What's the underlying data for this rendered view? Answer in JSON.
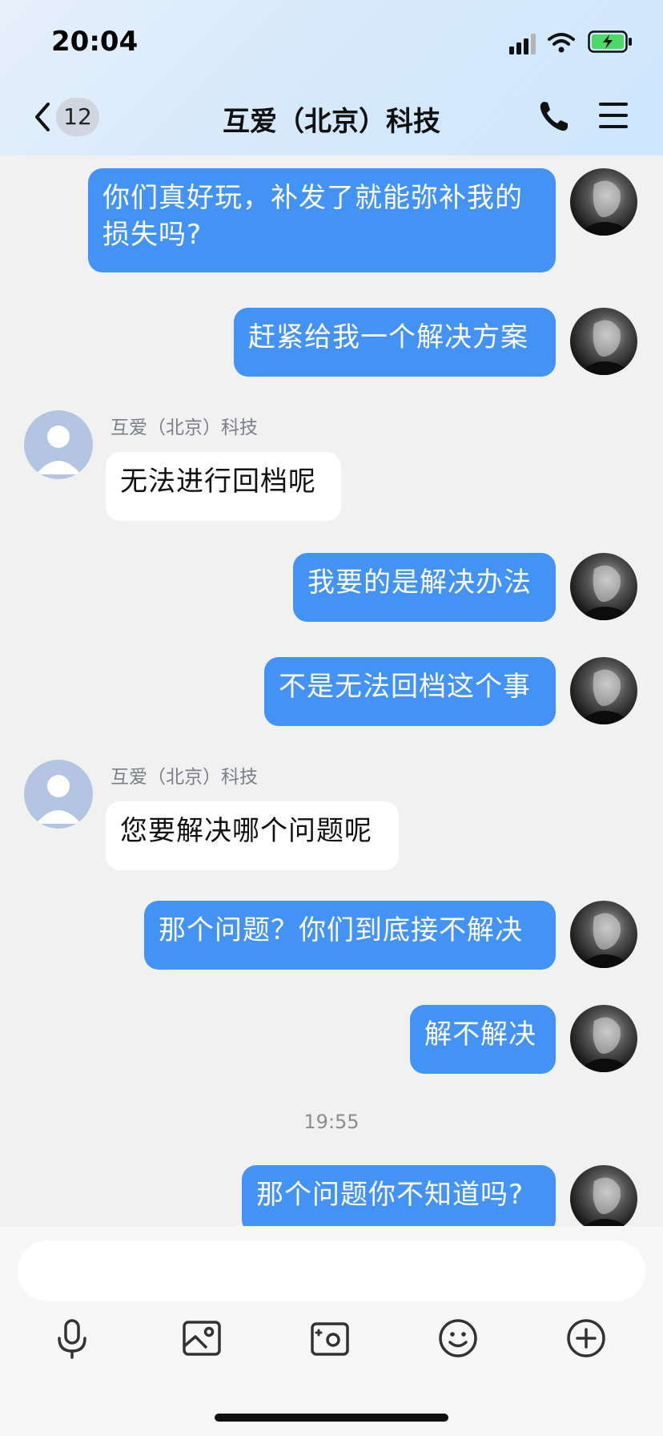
{
  "status_bar": {
    "time": "20:04"
  },
  "header": {
    "back_badge": "12",
    "title": "互爱（北京）科技"
  },
  "messages": [
    {
      "dir": "out",
      "text": "你们真好玩，补发了就能弥补我的损失吗?"
    },
    {
      "dir": "out",
      "text": "赶紧给我一个解决方案"
    },
    {
      "dir": "in",
      "sender": "互爱（北京）科技",
      "text": "无法进行回档呢"
    },
    {
      "dir": "out",
      "text": "我要的是解决办法"
    },
    {
      "dir": "out",
      "text": "不是无法回档这个事"
    },
    {
      "dir": "in",
      "sender": "互爱（北京）科技",
      "text": "您要解决哪个问题呢"
    },
    {
      "dir": "out",
      "text": "那个问题？你们到底接不解决"
    },
    {
      "dir": "out",
      "text": "解不解决"
    },
    {
      "dir": "time",
      "text": "19:55"
    },
    {
      "dir": "out",
      "text": "那个问题你不知道吗?"
    }
  ],
  "input": {
    "placeholder": ""
  },
  "toolbar": {
    "icons": [
      "microphone-icon",
      "image-icon",
      "camera-icon",
      "emoji-icon",
      "plus-icon"
    ]
  },
  "colors": {
    "accent": "#4293f5",
    "background": "#f1f1f1"
  }
}
